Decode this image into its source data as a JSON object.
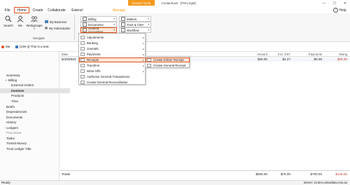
{
  "window": {
    "contextual_tab": "Invoice Tools",
    "title": "ContactLaw - [FM-Legal]",
    "minimize": "—",
    "maximize": "☐",
    "close": "✕"
  },
  "menu_tabs": [
    "File",
    "Home",
    "Create",
    "Collaborate",
    "Extend",
    "Manage"
  ],
  "help_label": "Help",
  "ribbon": {
    "search": "Search",
    "me": "Me",
    "workgroups": "Workgroups",
    "my_business": "My Business",
    "my_subscription": "My Subscription",
    "navigate": "Navigate",
    "col1": [
      "Billing",
      "Documents",
      "General Accounting"
    ],
    "col2": [
      "Matters",
      "Trust & CMA",
      "Workflow"
    ]
  },
  "record_bar": {
    "me_label": "Me",
    "record": "[109-2] This is a test."
  },
  "sidebar": {
    "items": [
      "Summary",
      "Billing",
      "External Orders",
      "Invoices",
      "Products",
      "Time",
      "Briefs",
      "Dependencies",
      "Documents",
      "History",
      "Ledgers",
      "Processes",
      "Tasks",
      "Transit Money",
      "Trust Ledger Title"
    ]
  },
  "grid": {
    "headers": [
      "Date",
      "Amount",
      "Incl. GST",
      "Payments",
      "Owing"
    ],
    "row": [
      "9/10/2024",
      "$25.00",
      "$2.27",
      "$0.00",
      "$25.00"
    ],
    "totals_label": "Totals",
    "totals": [
      "$925.00",
      "$75.00",
      "$700.00",
      "$125.00"
    ]
  },
  "gen_accounting_menu": [
    "Adjustments",
    "Banking",
    "Journals",
    "Payments",
    "Receipts",
    "Transfers",
    "Write-Offs",
    "Authorise General Transactions",
    "Create General Reconciliation"
  ],
  "receipts_menu": [
    "Create Debtor Receipt",
    "Create General Receipt"
  ],
  "status": {
    "left": "Ready",
    "right": "Server: v2.dev.contactlaw.com.au"
  },
  "colors": {
    "accent": "#e2501a",
    "manage": "#f39a1e",
    "owing": "#c0392b"
  }
}
